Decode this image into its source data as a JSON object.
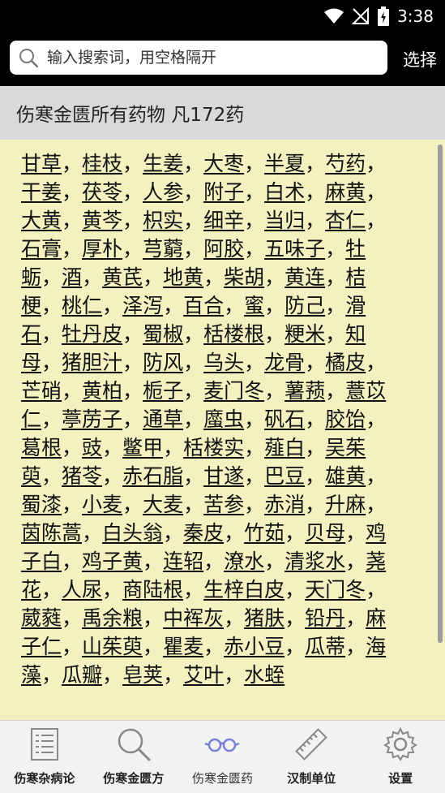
{
  "status": {
    "time": "3:38"
  },
  "search": {
    "placeholder": "输入搜索词，用空格隔开",
    "choose_label": "选择"
  },
  "header": {
    "title": "伤寒金匮所有药物  凡172药"
  },
  "herbs": [
    "甘草",
    "桂枝",
    "生姜",
    "大枣",
    "半夏",
    "芍药",
    "干姜",
    "茯苓",
    "人参",
    "附子",
    "白术",
    "麻黄",
    "大黄",
    "黄芩",
    "枳实",
    "细辛",
    "当归",
    "杏仁",
    "石膏",
    "厚朴",
    "芎藭",
    "阿胶",
    "五味子",
    "牡蛎",
    "酒",
    "黄芪",
    "地黄",
    "柴胡",
    "黄连",
    "桔梗",
    "桃仁",
    "泽泻",
    "百合",
    "蜜",
    "防己",
    "滑石",
    "牡丹皮",
    "蜀椒",
    "栝楼根",
    "粳米",
    "知母",
    "猪胆汁",
    "防风",
    "乌头",
    "龙骨",
    "橘皮",
    "芒硝",
    "黄柏",
    "栀子",
    "麦门冬",
    "薯蓣",
    "薏苡仁",
    "葶苈子",
    "通草",
    "䗪虫",
    "矾石",
    "胶饴",
    "葛根",
    "豉",
    "鳖甲",
    "栝楼实",
    "薤白",
    "吴茱萸",
    "猪苓",
    "赤石脂",
    "甘遂",
    "巴豆",
    "雄黄",
    "蜀漆",
    "小麦",
    "大麦",
    "苦参",
    "赤消",
    "升麻",
    "茵陈蒿",
    "白头翁",
    "秦皮",
    "竹茹",
    "贝母",
    "鸡子白",
    "鸡子黄",
    "连轺",
    "潦水",
    "清浆水",
    "荛花",
    "人尿",
    "商陆根",
    "生梓白皮",
    "天门冬",
    "葳蕤",
    "禹余粮",
    "中裈灰",
    "猪肤",
    "铅丹",
    "麻子仁",
    "山茱萸",
    "瞿麦",
    "赤小豆",
    "瓜蒂",
    "海藻",
    "瓜瓣",
    "皂荚",
    "艾叶",
    "水蛭"
  ],
  "separator": "，",
  "nav": {
    "items": [
      {
        "label": "伤寒杂病论",
        "icon": "list-icon"
      },
      {
        "label": "伤寒金匮方",
        "icon": "search-icon"
      },
      {
        "label": "伤寒金匮药",
        "icon": "glasses-icon"
      },
      {
        "label": "汉制单位",
        "icon": "ruler-icon"
      },
      {
        "label": "设置",
        "icon": "gear-icon"
      }
    ]
  },
  "colors": {
    "content_bg": "#f3f1bf",
    "header_bg": "#d9d9d9",
    "accent_active": "#7a7fd6"
  }
}
